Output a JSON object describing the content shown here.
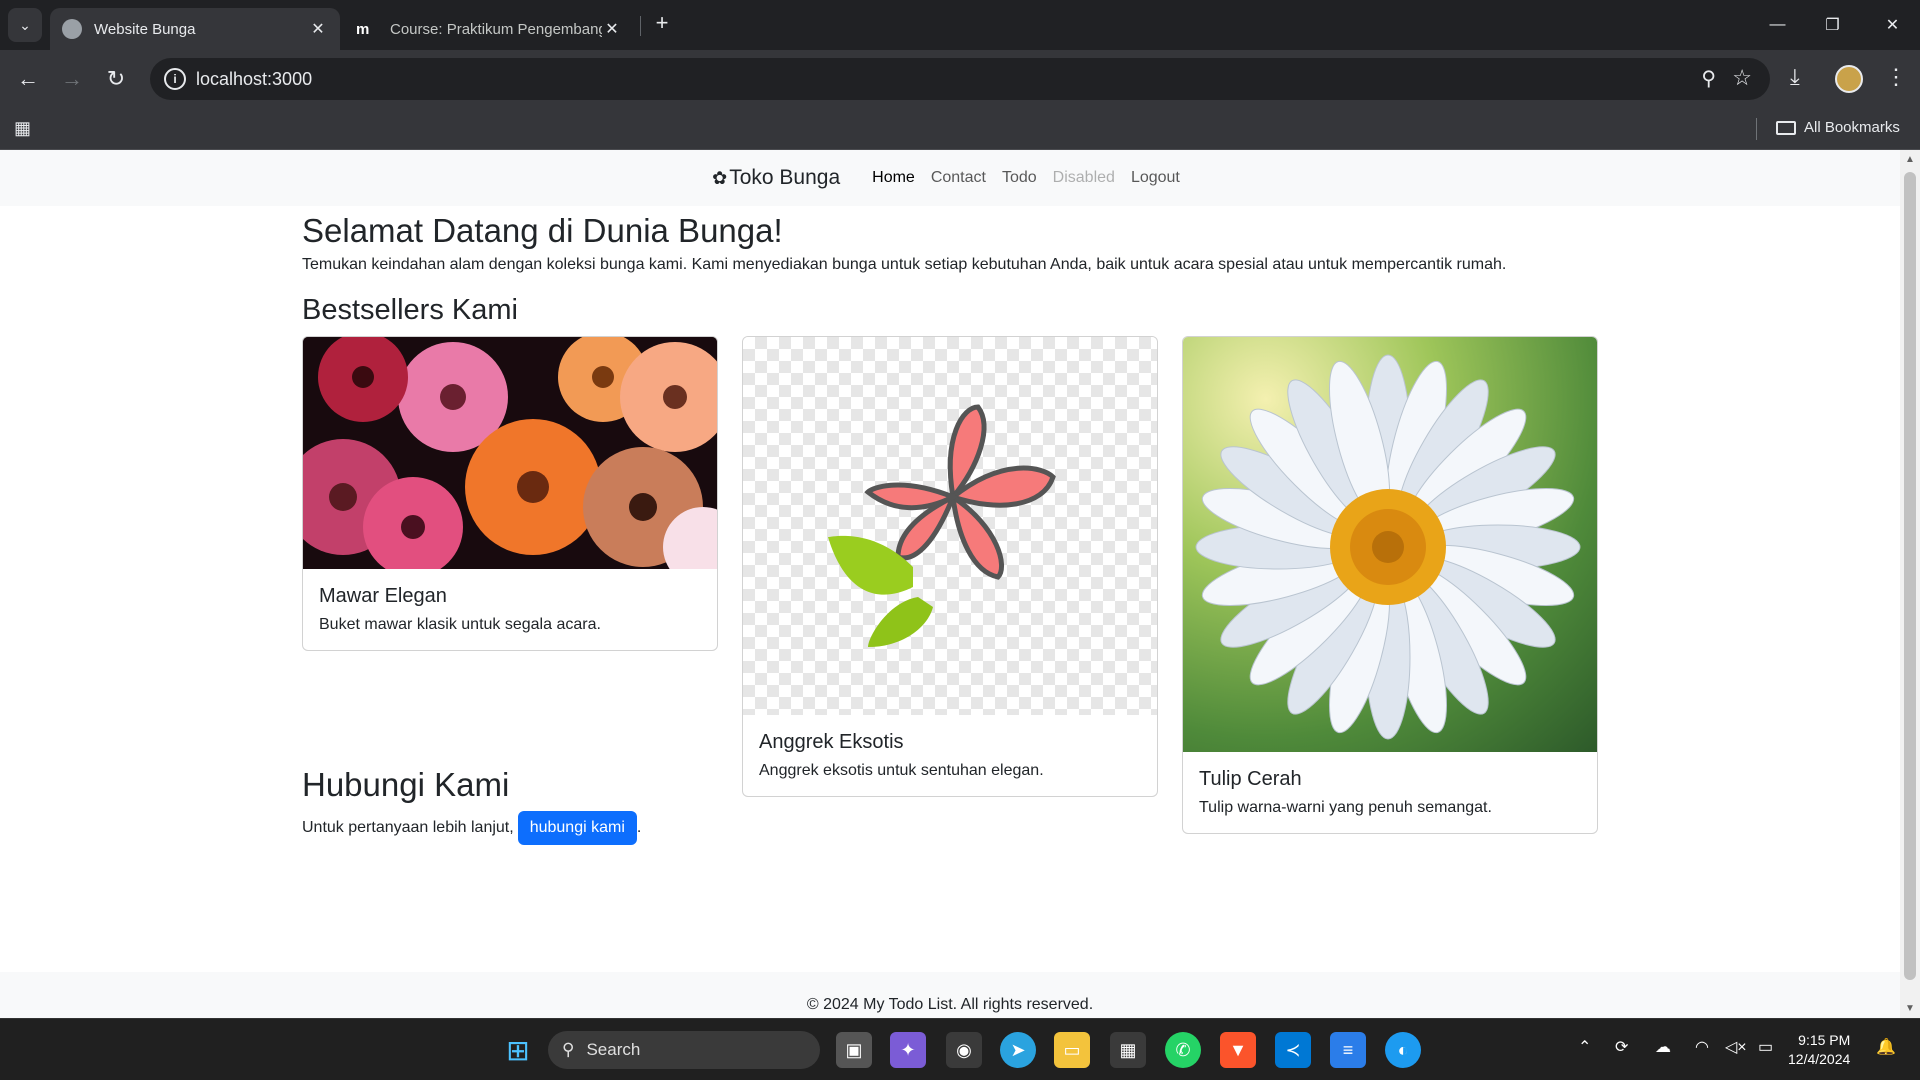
{
  "browser": {
    "tabs": [
      {
        "title": "Website Bunga",
        "active": true
      },
      {
        "title": "Course: Praktikum Pengembang",
        "active": false
      }
    ],
    "url": "localhost:3000",
    "bookmarks_label": "All Bookmarks"
  },
  "navbar": {
    "brand": "Toko Bunga",
    "links": [
      {
        "label": "Home",
        "state": "active"
      },
      {
        "label": "Contact",
        "state": "normal"
      },
      {
        "label": "Todo",
        "state": "normal"
      },
      {
        "label": "Disabled",
        "state": "disabled"
      },
      {
        "label": "Logout",
        "state": "normal"
      }
    ]
  },
  "hero": {
    "title": "Selamat Datang di Dunia Bunga!",
    "text": "Temukan keindahan alam dengan koleksi bunga kami. Kami menyediakan bunga untuk setiap kebutuhan Anda, baik untuk acara spesial atau untuk mempercantik rumah."
  },
  "bestsellers": {
    "heading": "Bestsellers Kami",
    "cards": [
      {
        "title": "Mawar Elegan",
        "text": "Buket mawar klasik untuk segala acara."
      },
      {
        "title": "Anggrek Eksotis",
        "text": "Anggrek eksotis untuk sentuhan elegan."
      },
      {
        "title": "Tulip Cerah",
        "text": "Tulip warna-warni yang penuh semangat."
      }
    ]
  },
  "contact": {
    "heading": "Hubungi Kami",
    "text": "Untuk pertanyaan lebih lanjut,",
    "button": "hubungi kami",
    "trailing": "."
  },
  "footer": {
    "text": "© 2024 My Todo List. All rights reserved."
  },
  "taskbar": {
    "search_label": "Search",
    "time": "9:15 PM",
    "date": "12/4/2024"
  },
  "colors": {
    "primary": "#0d6efd",
    "navbar_bg": "#f8f9fa",
    "chrome_dark": "#202124"
  }
}
